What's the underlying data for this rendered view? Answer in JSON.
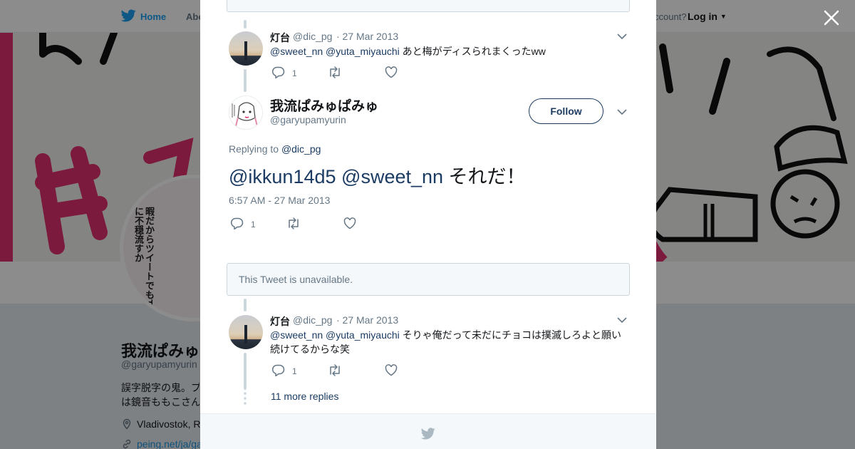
{
  "header": {
    "nav_home": "Home",
    "nav_about": "Abo",
    "account_prompt": "ccount?",
    "login": "Log in"
  },
  "profile": {
    "name": "我流ぱみゅぱ",
    "handle": "@garyupamyurin",
    "bio_line1": "誤字脱字の鬼。プ",
    "bio_line2": "は鏡音ももこさん",
    "location": "Vladivostok, R",
    "link": "peing.net/ja/ga",
    "avatar_text": "暇だからツイートでもTLに不穏流すか"
  },
  "modal": {
    "tweets": [
      {
        "name": "灯台",
        "handle": "@dic_pg",
        "date": "· 27 Mar 2013",
        "mention1": "@sweet_nn",
        "mention2": "@yuta_miyauchi",
        "text": "あと梅がディスられまくったww",
        "reply_count": "1"
      },
      {
        "name": "灯台",
        "handle": "@dic_pg",
        "date": "· 27 Mar 2013",
        "mention1": "@sweet_nn",
        "mention2": "@yuta_miyauchi",
        "text": "そりゃ俺だって未だにチョコは撲滅しろよと願い続けてるからな笑",
        "reply_count": "1"
      }
    ],
    "main": {
      "name": "我流ぱみゅぱみゅ",
      "handle": "@garyupamyurin",
      "follow_label": "Follow",
      "replying_prefix": "Replying to",
      "replying_to": "@dic_pg",
      "mention1": "@ikkun14d5",
      "mention2": "@sweet_nn",
      "text": "それだ！",
      "timestamp": "6:57 AM - 27 Mar 2013",
      "reply_count": "1"
    },
    "unavailable": "This Tweet is unavailable.",
    "more_replies": "11 more replies"
  },
  "colors": {
    "accent": "#1da1f2",
    "link_dark": "#1b3b63",
    "secondary_text": "#657786",
    "banner_pink": "#e0306e"
  },
  "icons": [
    "twitter-bird-icon",
    "close-icon",
    "reply-icon",
    "retweet-icon",
    "like-icon",
    "chevron-down-icon",
    "location-icon",
    "link-icon"
  ]
}
